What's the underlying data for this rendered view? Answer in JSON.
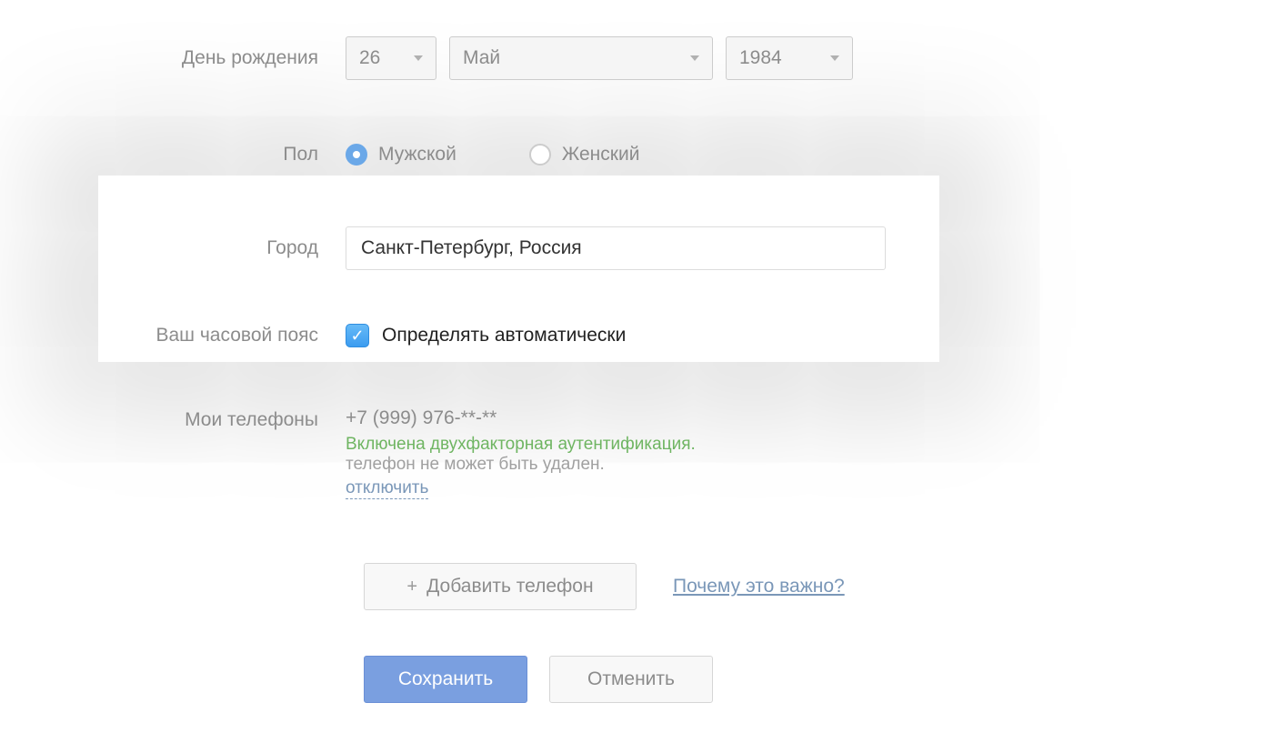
{
  "labels": {
    "birthday": "День рождения",
    "gender": "Пол",
    "city": "Город",
    "timezone": "Ваш часовой пояс",
    "phones": "Мои телефоны"
  },
  "birthday": {
    "day": "26",
    "month": "Май",
    "year": "1984"
  },
  "gender": {
    "male": "Мужской",
    "female": "Женский"
  },
  "city": {
    "value": "Санкт-Петербург, Россия"
  },
  "timezone": {
    "auto_label": "Определять автоматически"
  },
  "phone": {
    "number": "+7 (999) 976-**-**",
    "mfa_enabled": "Включена двухфакторная аутентификация.",
    "mfa_note": "телефон не может быть удален.",
    "disable_link": "отключить",
    "add_button": "Добавить телефон",
    "why_link": "Почему это важно?"
  },
  "actions": {
    "save": "Сохранить",
    "cancel": "Отменить"
  }
}
